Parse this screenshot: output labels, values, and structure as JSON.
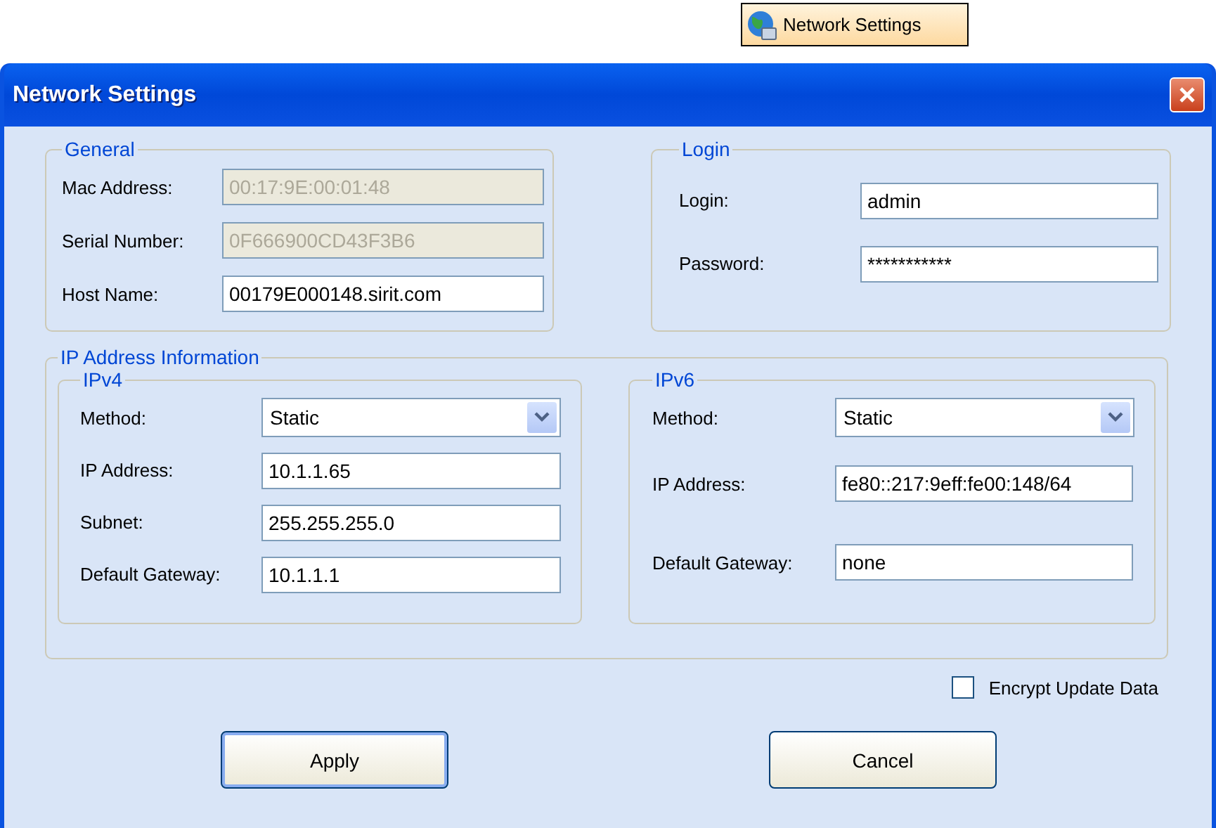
{
  "taskbar_button": {
    "label": "Network Settings"
  },
  "window": {
    "title": "Network Settings"
  },
  "general": {
    "title": "General",
    "fields": [
      {
        "label": "Mac Address:",
        "value": "00:17:9E:00:01:48",
        "disabled": true
      },
      {
        "label": "Serial Number:",
        "value": "0F666900CD43F3B6",
        "disabled": true
      },
      {
        "label": "Host Name:",
        "value": "00179E000148.sirit.com",
        "disabled": false
      }
    ]
  },
  "login": {
    "title": "Login",
    "fields": [
      {
        "label": "Login:",
        "value": "admin"
      },
      {
        "label": "Password:",
        "value": "***********"
      }
    ]
  },
  "ip_info": {
    "title": "IP Address Information",
    "ipv4": {
      "title": "IPv4",
      "method": {
        "label": "Method:",
        "value": "Static"
      },
      "fields": [
        {
          "label": "IP Address:",
          "value": "10.1.1.65"
        },
        {
          "label": "Subnet:",
          "value": "255.255.255.0"
        },
        {
          "label": "Default Gateway:",
          "value": "10.1.1.1"
        }
      ]
    },
    "ipv6": {
      "title": "IPv6",
      "method": {
        "label": "Method:",
        "value": "Static"
      },
      "fields": [
        {
          "label": "IP Address:",
          "value": "fe80::217:9eff:fe00:148/64"
        },
        {
          "label": "Default Gateway:",
          "value": "none"
        }
      ]
    }
  },
  "encrypt": {
    "label": "Encrypt Update Data",
    "checked": false
  },
  "buttons": [
    {
      "label": "Apply",
      "default": true
    },
    {
      "label": "Cancel",
      "default": false
    }
  ]
}
